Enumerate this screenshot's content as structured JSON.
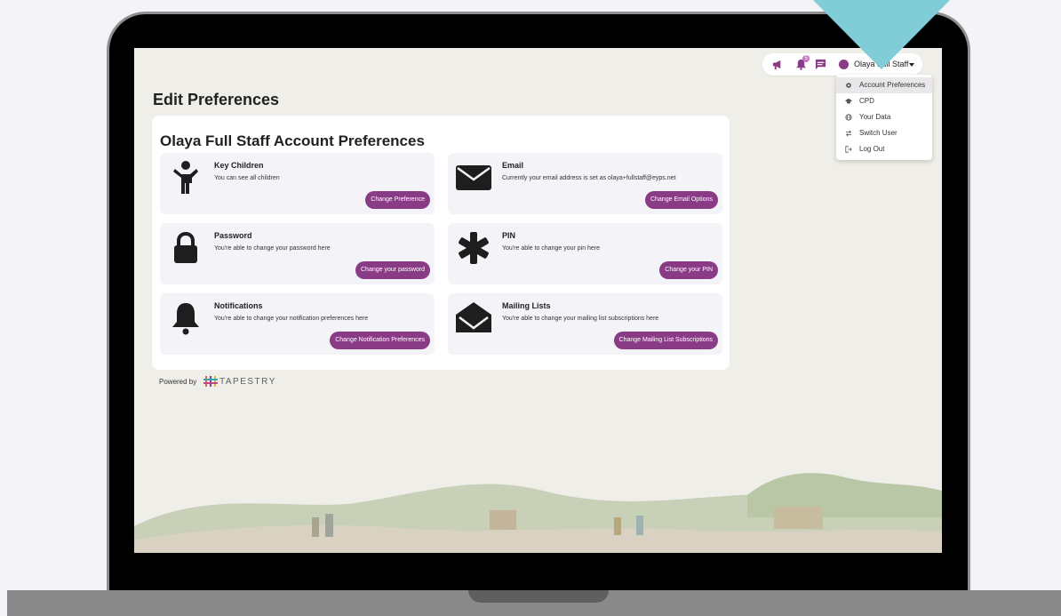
{
  "app": {
    "page_title": "Edit Preferences",
    "panel_title": "Olaya Full Staff Account Preferences"
  },
  "topbar": {
    "notification_count": "5",
    "user_name": "Olaya Full Staff"
  },
  "user_menu": {
    "items": [
      {
        "label": "Account Preferences",
        "icon": "gear-icon",
        "active": true
      },
      {
        "label": "CPD",
        "icon": "graduation-cap-icon",
        "active": false
      },
      {
        "label": "Your Data",
        "icon": "globe-icon",
        "active": false
      },
      {
        "label": "Switch User",
        "icon": "swap-arrows-icon",
        "active": false
      },
      {
        "label": "Log Out",
        "icon": "logout-icon",
        "active": false
      }
    ]
  },
  "cards": {
    "key_children": {
      "title": "Key Children",
      "desc": "You can see all children",
      "button": "Change Preference",
      "icon": "child-icon"
    },
    "email": {
      "title": "Email",
      "desc": "Currently your email address is set as olaya+fullstaff@eyps.net",
      "button": "Change Email Options",
      "icon": "envelope-icon"
    },
    "password": {
      "title": "Password",
      "desc": "You're able to change your password here",
      "button": "Change your password",
      "icon": "lock-icon"
    },
    "pin": {
      "title": "PIN",
      "desc": "You're able to change your pin here",
      "button": "Change your PIN",
      "icon": "asterisk-icon"
    },
    "notifications": {
      "title": "Notifications",
      "desc": "You're able to change your notification preferences here",
      "button": "Change Notification Preferences",
      "icon": "bell-icon"
    },
    "mailing_lists": {
      "title": "Mailing Lists",
      "desc": "You're able to change your mailing list subscriptions here",
      "button": "Change Mailing List Subscriptions",
      "icon": "open-envelope-icon"
    }
  },
  "footer": {
    "powered_by": "Powered by",
    "brand": "TAPESTRY"
  },
  "colors": {
    "accent": "#8a3b86",
    "card_bg": "#f4f3f8",
    "cursor": "#80cdd7"
  }
}
